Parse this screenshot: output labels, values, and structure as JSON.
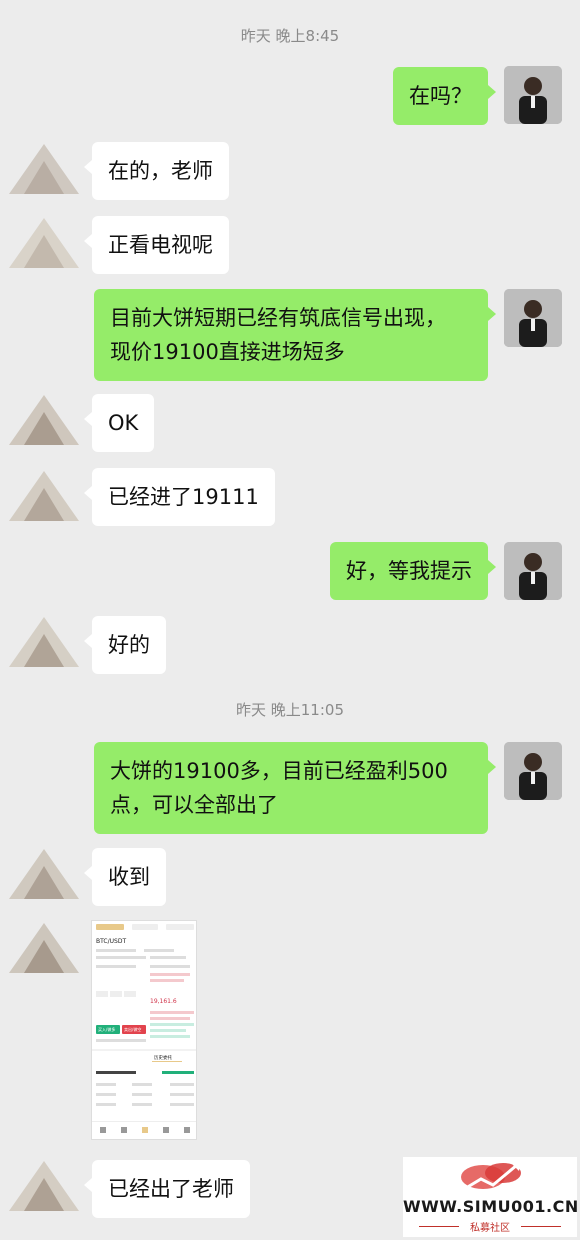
{
  "timestamps": [
    "昨天 晚上8:45",
    "昨天 晚上11:05"
  ],
  "messages": [
    {
      "from": "me",
      "text": "在吗？"
    },
    {
      "from": "them",
      "text": "在的，老师"
    },
    {
      "from": "them",
      "text": "正看电视呢"
    },
    {
      "from": "me",
      "lines": [
        "目前大饼短期已经有筑底信号出现，",
        "现价19100直接进场短多"
      ]
    },
    {
      "from": "them",
      "text": "OK"
    },
    {
      "from": "them",
      "text": "已经进了19111"
    },
    {
      "from": "me",
      "text": "好，等我提示"
    },
    {
      "from": "them",
      "text": "好的"
    },
    {
      "from": "me",
      "lines": [
        "大饼的19100多，目前已经盈利500",
        "点，可以全部出了"
      ]
    },
    {
      "from": "them",
      "text": "收到"
    },
    {
      "from": "them",
      "text": "已经出了老师"
    }
  ],
  "shared_image": {
    "pair": "BTC/USDT",
    "buy_label": "买入/做多",
    "sell_label": "卖出/做空",
    "tab": "历史委托",
    "price": "19,161.6"
  },
  "watermark": {
    "url": "WWW.SIMU001.CN",
    "sub": "私募社区"
  },
  "colors": {
    "chat_bg": "#ececec",
    "out_bubble": "#95ec69",
    "in_bubble": "#ffffff",
    "brand_red": "#c0302a"
  }
}
